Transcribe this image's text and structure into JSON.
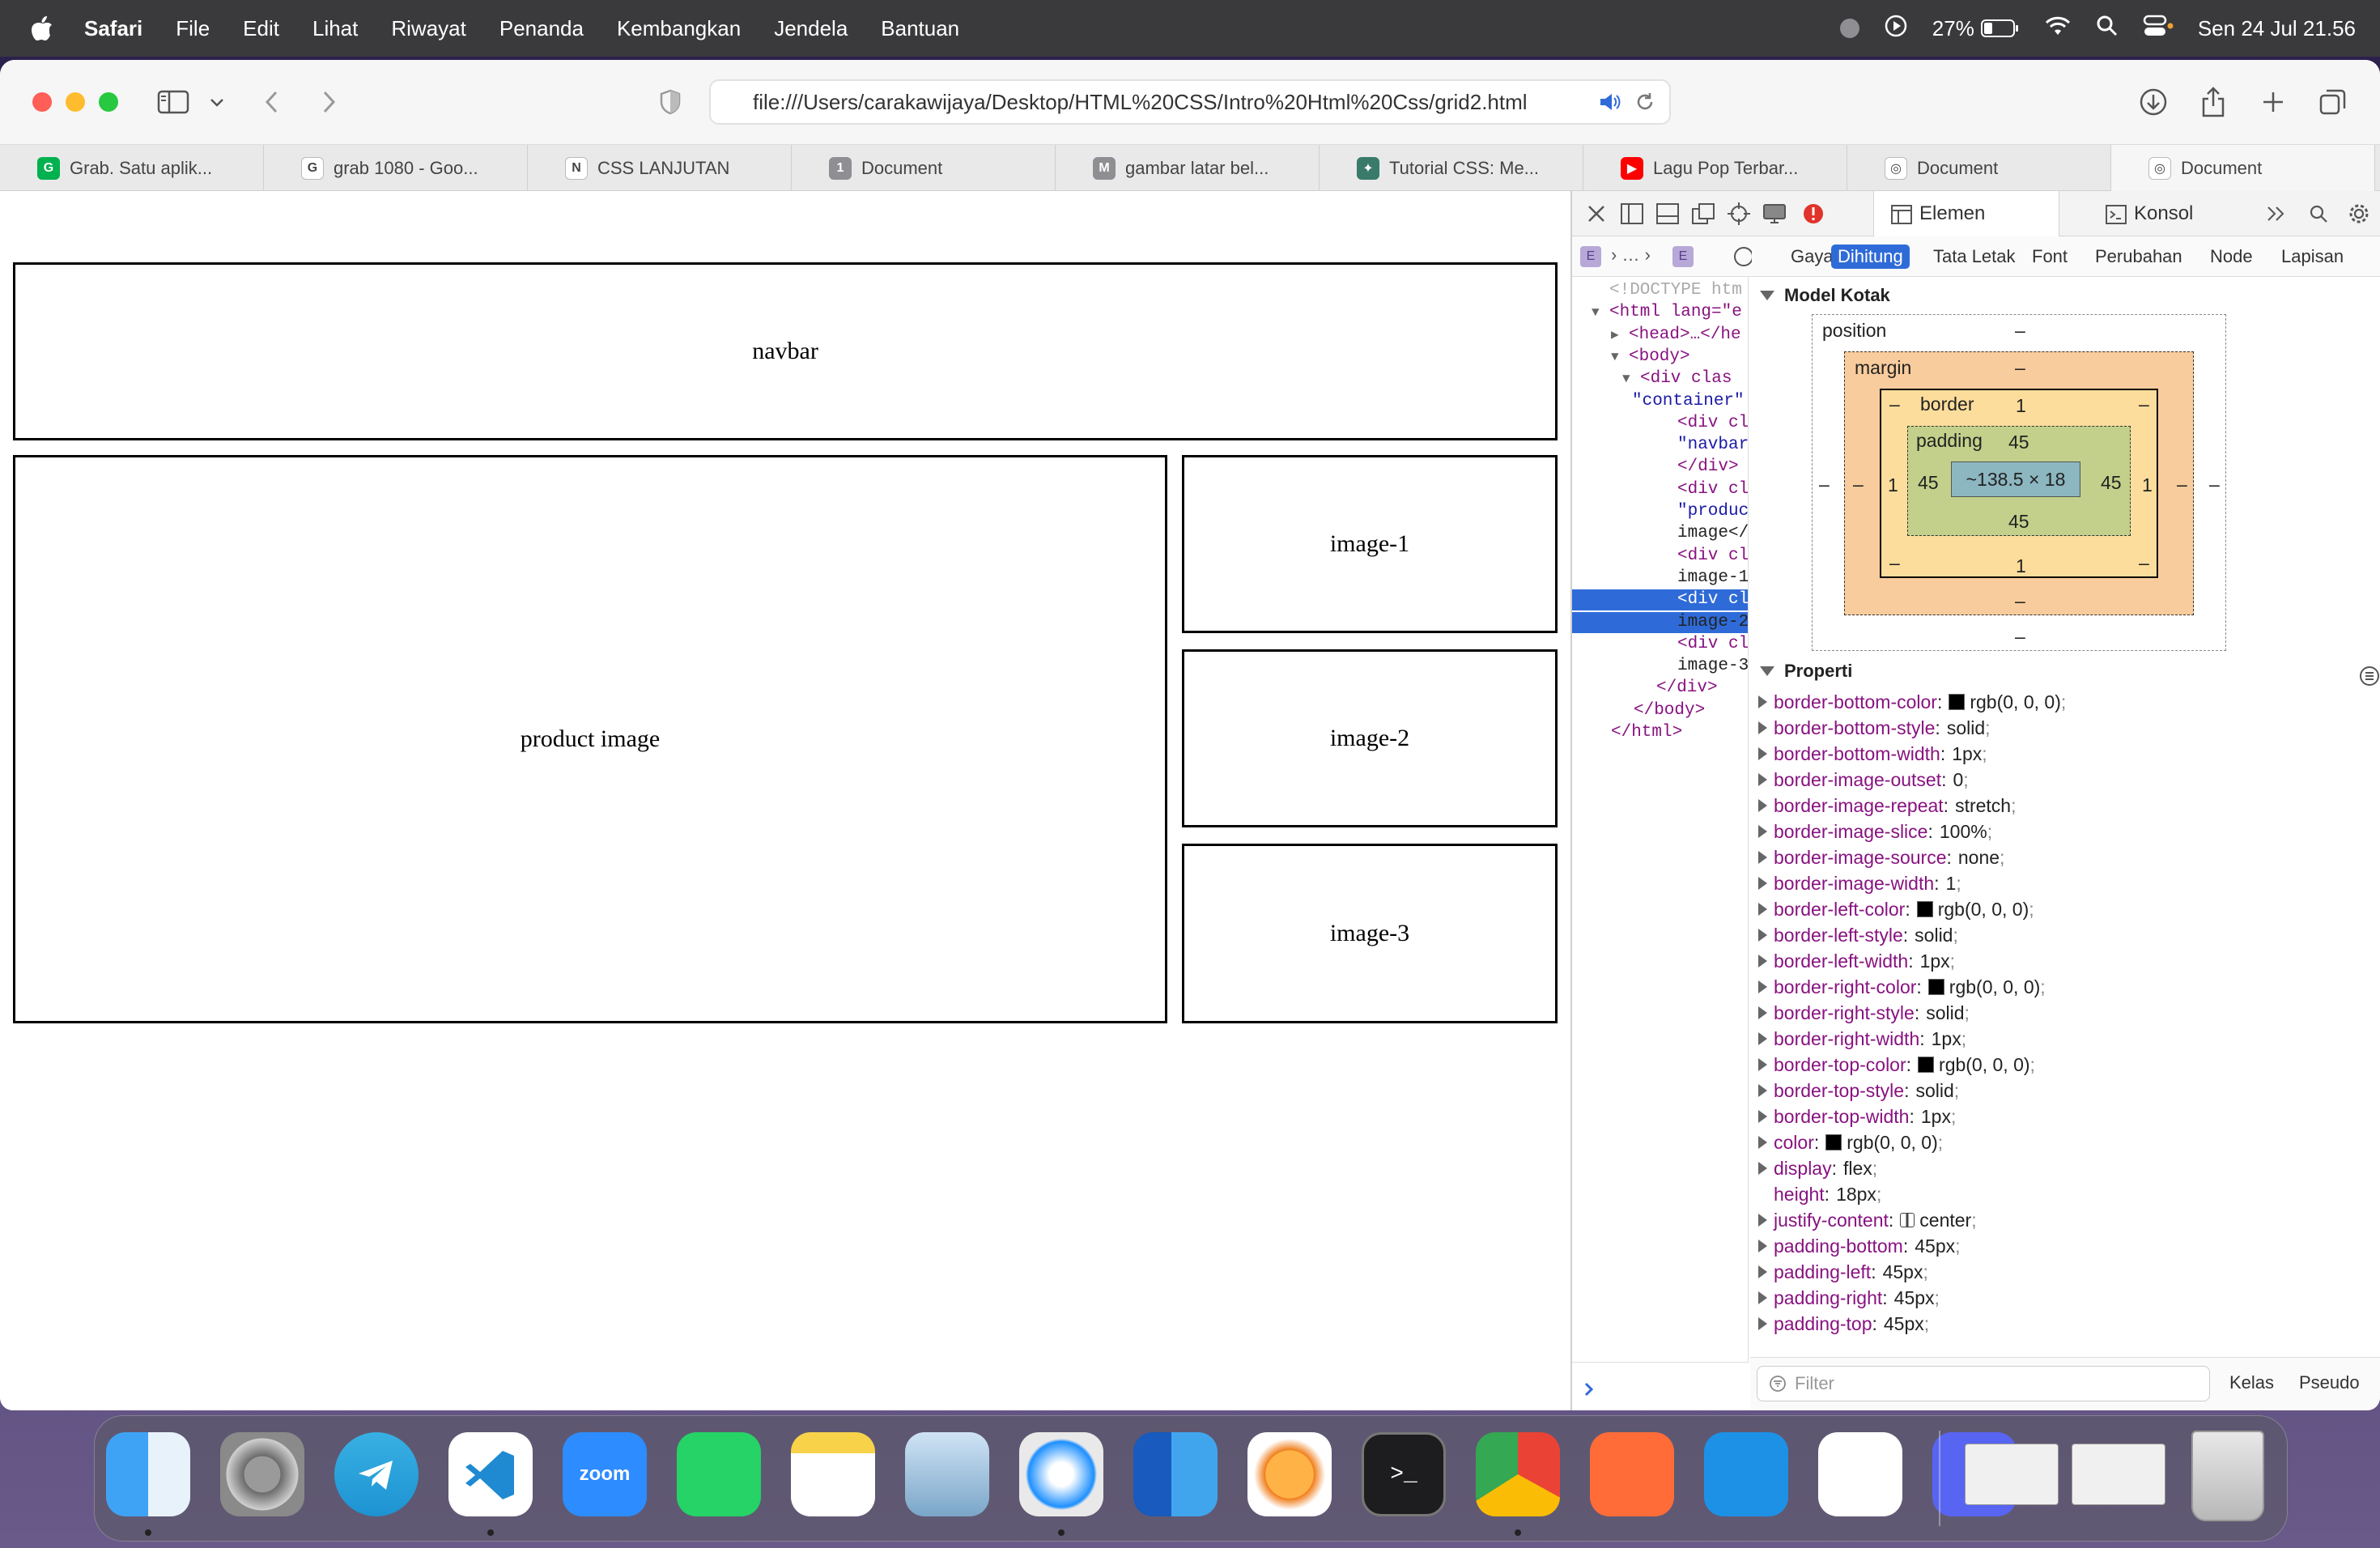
{
  "menubar": {
    "app_name": "Safari",
    "items": [
      "File",
      "Edit",
      "Lihat",
      "Riwayat",
      "Penanda",
      "Kembangkan",
      "Jendela",
      "Bantuan"
    ],
    "battery": "27%",
    "datetime": "Sen 24 Jul  21.56"
  },
  "browser": {
    "url": "file:///Users/carakawijaya/Desktop/HTML%20CSS/Intro%20Html%20Css/grid2.html",
    "tabs": [
      {
        "label": "Grab. Satu aplik...",
        "icon": "grab-icon",
        "color": "#00b14f",
        "glyph": "Grab"
      },
      {
        "label": "grab 1080 - Goo...",
        "icon": "google-icon",
        "color": "#ffffff",
        "glyph": "G"
      },
      {
        "label": "CSS LANJUTAN",
        "icon": "notion-icon",
        "color": "#ffffff",
        "glyph": "N"
      },
      {
        "label": "Document",
        "icon": "number-one-icon",
        "color": "#8e8e93",
        "glyph": "1"
      },
      {
        "label": "gambar latar bel...",
        "icon": "m-icon",
        "color": "#8e8e93",
        "glyph": "M"
      },
      {
        "label": "Tutorial CSS: Me...",
        "icon": "tutorial-icon",
        "color": "#3a7a6a",
        "glyph": "✦"
      },
      {
        "label": "Lagu Pop Terbar...",
        "icon": "youtube-icon",
        "color": "#ff0000",
        "glyph": "▶"
      },
      {
        "label": "Document",
        "icon": "compass-icon",
        "color": "#ffffff",
        "glyph": "◎"
      },
      {
        "label": "Document",
        "icon": "compass-icon",
        "color": "#ffffff",
        "glyph": "◎"
      }
    ]
  },
  "page": {
    "navbar": "navbar",
    "product_image": "product image",
    "image1": "image-1",
    "image2": "image-2",
    "image3": "image-3"
  },
  "devtools": {
    "tabs": [
      "Elemen",
      "Konsol"
    ],
    "subtabs": [
      "Gaya",
      "Dihitung",
      "Tata Letak",
      "Font",
      "Perubahan",
      "Node",
      "Lapisan"
    ],
    "breadcrumb": "…",
    "dom_lines": [
      "<!DOCTYPE htm",
      "<html lang=\"e",
      "<head>…</he",
      "<body>",
      "<div clas",
      "\"container\":",
      "<div cl",
      "\"navbar",
      "</div>",
      "<div cl",
      "\"produc",
      "image</",
      "<div cl",
      "image-1",
      "<div cl",
      "image-2",
      "<div cl",
      "image-3",
      "</div>",
      "</body>",
      "</html>"
    ],
    "box_model_title": "Model Kotak",
    "box_model": {
      "position_label": "position",
      "margin_label": "margin",
      "border_label": "border",
      "padding_label": "padding",
      "dash": "–",
      "border_top": "1",
      "border_bottom": "1",
      "border_left": "1",
      "border_right": "1",
      "padding_top": "45",
      "padding_bottom": "45",
      "padding_left": "45",
      "padding_right": "45",
      "content": "~138.5 × 18"
    },
    "properties_title": "Properti",
    "properties": [
      {
        "name": "border-bottom-color",
        "value": "rgb(0, 0, 0)",
        "swatch": true,
        "expand": true
      },
      {
        "name": "border-bottom-style",
        "value": "solid",
        "expand": true
      },
      {
        "name": "border-bottom-width",
        "value": "1px",
        "expand": true
      },
      {
        "name": "border-image-outset",
        "value": "0",
        "expand": true
      },
      {
        "name": "border-image-repeat",
        "value": "stretch",
        "expand": true
      },
      {
        "name": "border-image-slice",
        "value": "100%",
        "expand": true
      },
      {
        "name": "border-image-source",
        "value": "none",
        "expand": true
      },
      {
        "name": "border-image-width",
        "value": "1",
        "expand": true
      },
      {
        "name": "border-left-color",
        "value": "rgb(0, 0, 0)",
        "swatch": true,
        "expand": true
      },
      {
        "name": "border-left-style",
        "value": "solid",
        "expand": true
      },
      {
        "name": "border-left-width",
        "value": "1px",
        "expand": true
      },
      {
        "name": "border-right-color",
        "value": "rgb(0, 0, 0)",
        "swatch": true,
        "expand": true
      },
      {
        "name": "border-right-style",
        "value": "solid",
        "expand": true
      },
      {
        "name": "border-right-width",
        "value": "1px",
        "expand": true
      },
      {
        "name": "border-top-color",
        "value": "rgb(0, 0, 0)",
        "swatch": true,
        "expand": true
      },
      {
        "name": "border-top-style",
        "value": "solid",
        "expand": true
      },
      {
        "name": "border-top-width",
        "value": "1px",
        "expand": true
      },
      {
        "name": "color",
        "value": "rgb(0, 0, 0)",
        "swatch": true,
        "expand": true
      },
      {
        "name": "display",
        "value": "flex",
        "expand": true
      },
      {
        "name": "height",
        "value": "18px",
        "expand": false
      },
      {
        "name": "justify-content",
        "value": "center",
        "expand": true,
        "flexicon": true
      },
      {
        "name": "padding-bottom",
        "value": "45px",
        "expand": true
      },
      {
        "name": "padding-left",
        "value": "45px",
        "expand": true
      },
      {
        "name": "padding-right",
        "value": "45px",
        "expand": true
      },
      {
        "name": "padding-top",
        "value": "45px",
        "expand": true
      }
    ],
    "filter_placeholder": "Filter",
    "class_label": "Kelas",
    "pseudo_label": "Pseudo"
  },
  "dock": {
    "zoom_label": "zoom",
    "apps": [
      "finder-icon",
      "system-settings-icon",
      "telegram-icon",
      "vscode-icon",
      "zoom-icon",
      "whatsapp-icon",
      "notes-icon",
      "preview-icon",
      "safari-icon",
      "word-icon",
      "infuse-icon",
      "terminal-icon",
      "chrome-icon",
      "postman-icon",
      "docker-icon",
      "tableplus-icon",
      "discord-icon"
    ]
  },
  "colors": {
    "accent": "#2f6bd8",
    "tag": "#881280",
    "margin_fill": "#f9cc9d",
    "border_fill": "#fddd9b",
    "padding_fill": "#c3d08b",
    "content_fill": "#8cb6c0"
  }
}
